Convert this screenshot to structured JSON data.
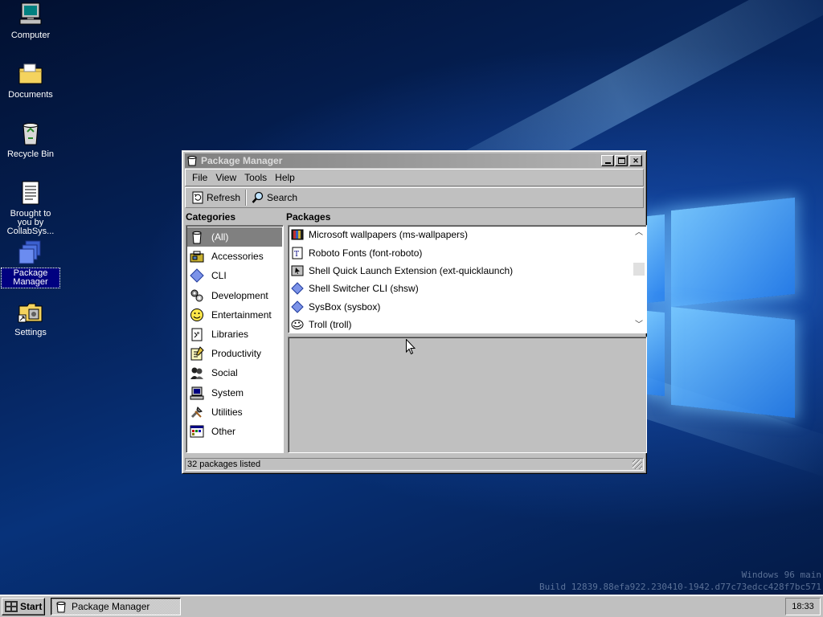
{
  "desktop": {
    "icons": [
      {
        "label": "Computer",
        "icon": "computer-icon"
      },
      {
        "label": "Documents",
        "icon": "folder-icon"
      },
      {
        "label": "Recycle Bin",
        "icon": "recycle-bin-icon"
      },
      {
        "label": "Brought to you by CollabSys...",
        "icon": "document-icon"
      },
      {
        "label": "Package Manager",
        "icon": "package-manager-icon",
        "selected": true
      },
      {
        "label": "Settings",
        "icon": "settings-icon"
      }
    ],
    "watermark": {
      "line1": "Windows 96 main",
      "line2": "Build 12839.88efa922.230410-1942.d77c73edcc428f7bc571"
    }
  },
  "window": {
    "title": "Package Manager",
    "menu": [
      "File",
      "View",
      "Tools",
      "Help"
    ],
    "toolbar": {
      "refresh_label": "Refresh",
      "search_label": "Search"
    },
    "categories_header": "Categories",
    "packages_header": "Packages",
    "categories": [
      {
        "label": "(All)",
        "icon": "all-icon",
        "selected": true
      },
      {
        "label": "Accessories",
        "icon": "accessories-icon"
      },
      {
        "label": "CLI",
        "icon": "cli-diamond-icon"
      },
      {
        "label": "Development",
        "icon": "development-icon"
      },
      {
        "label": "Entertainment",
        "icon": "smiley-icon"
      },
      {
        "label": "Libraries",
        "icon": "libraries-icon"
      },
      {
        "label": "Productivity",
        "icon": "productivity-icon"
      },
      {
        "label": "Social",
        "icon": "social-icon"
      },
      {
        "label": "System",
        "icon": "system-icon"
      },
      {
        "label": "Utilities",
        "icon": "utilities-icon"
      },
      {
        "label": "Other",
        "icon": "other-icon"
      }
    ],
    "packages": [
      {
        "label": "Microsoft wallpapers (ms-wallpapers)",
        "icon": "wallpapers-icon"
      },
      {
        "label": "Roboto Fonts (font-roboto)",
        "icon": "font-icon"
      },
      {
        "label": "Shell Quick Launch Extension (ext-quicklaunch)",
        "icon": "extension-icon"
      },
      {
        "label": "Shell Switcher CLI (shsw)",
        "icon": "cli-diamond-icon"
      },
      {
        "label": "SysBox (sysbox)",
        "icon": "cli-diamond-icon"
      },
      {
        "label": "Troll (troll)",
        "icon": "troll-icon"
      }
    ],
    "status": "32 packages listed"
  },
  "taskbar": {
    "start_label": "Start",
    "task_label": "Package Manager",
    "clock": "18:33"
  }
}
